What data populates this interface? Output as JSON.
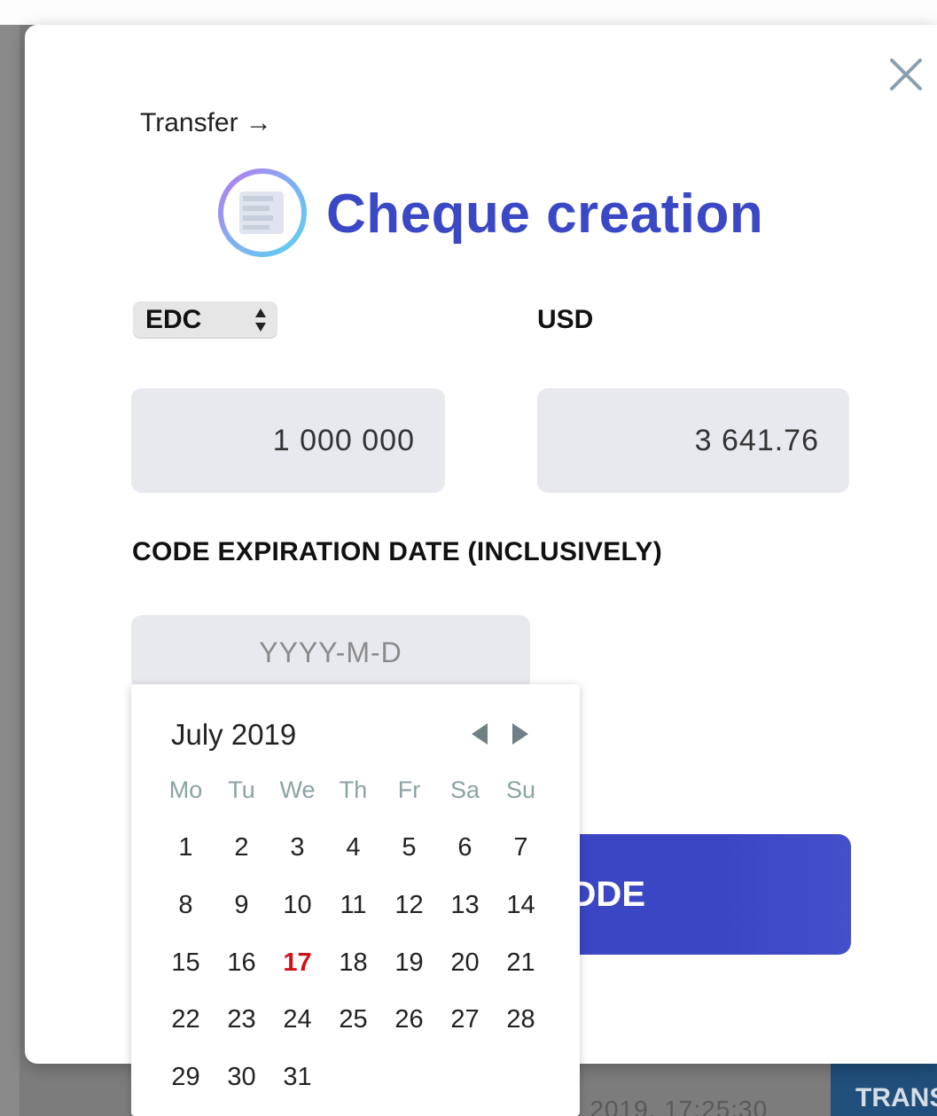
{
  "background": {
    "timestamp_fragment": "6 2019, 17:25:30",
    "transfer_button_fragment": "TRANS"
  },
  "modal": {
    "breadcrumb": "Transfer →",
    "title": "Cheque creation",
    "currency_select": {
      "value": "EDC"
    },
    "usd_label": "USD",
    "amount_edc": "1 000 000",
    "amount_usd": "3 641.76",
    "expiry_label": "CODE EXPIRATION DATE (INCLUSIVELY)",
    "date_placeholder": "YYYY-M-D",
    "create_button_fragment": "DDE"
  },
  "calendar": {
    "month_label": "July 2019",
    "weekdays": [
      "Mo",
      "Tu",
      "We",
      "Th",
      "Fr",
      "Sa",
      "Su"
    ],
    "weeks": [
      [
        "1",
        "2",
        "3",
        "4",
        "5",
        "6",
        "7"
      ],
      [
        "8",
        "9",
        "10",
        "11",
        "12",
        "13",
        "14"
      ],
      [
        "15",
        "16",
        "17",
        "18",
        "19",
        "20",
        "21"
      ],
      [
        "22",
        "23",
        "24",
        "25",
        "26",
        "27",
        "28"
      ],
      [
        "29",
        "30",
        "31",
        "",
        "",
        "",
        ""
      ]
    ],
    "today": "17"
  },
  "colors": {
    "accent": "#3a48c6",
    "today": "#d0111b",
    "field_bg": "#e8e9ef"
  },
  "icons": [
    "close-icon",
    "edc-logo-icon",
    "select-arrows-icon",
    "prev-month-icon",
    "next-month-icon"
  ]
}
